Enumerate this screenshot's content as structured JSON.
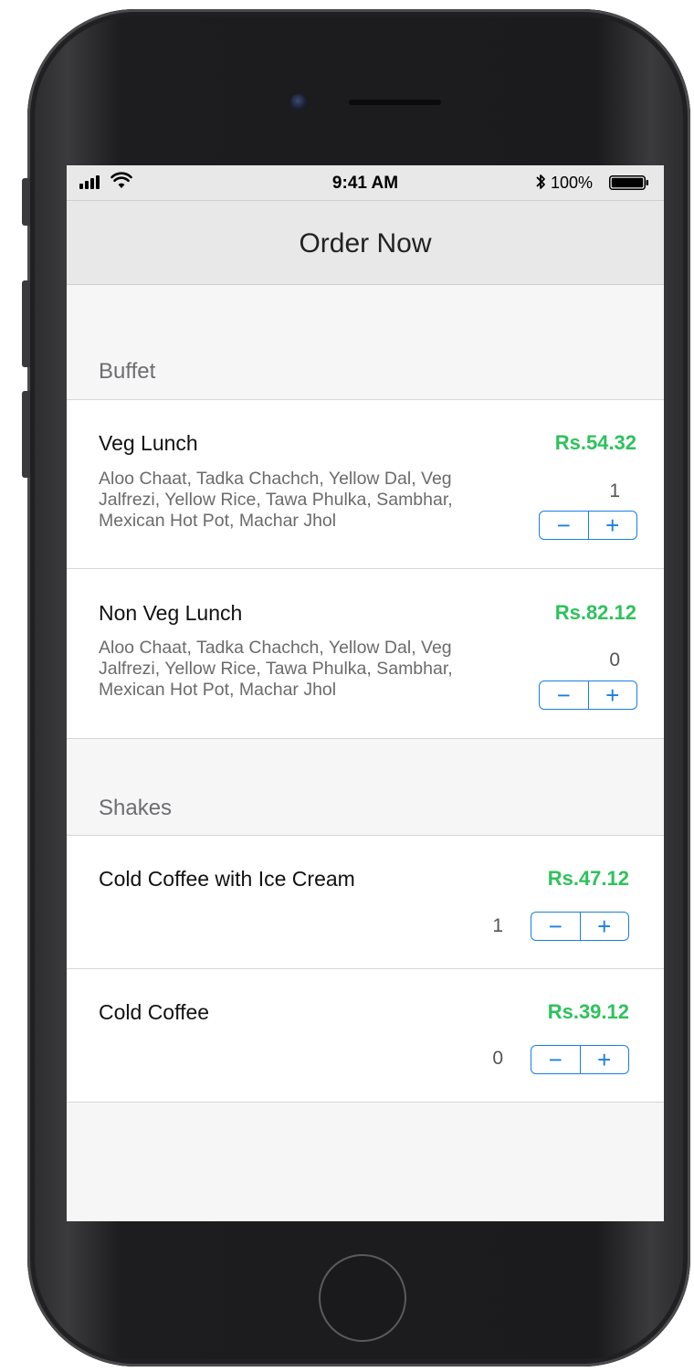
{
  "status_bar": {
    "time": "9:41 AM",
    "battery_percent": "100%",
    "icons": [
      "signal-icon",
      "wifi-icon",
      "bluetooth-icon",
      "battery-icon"
    ]
  },
  "nav": {
    "title": "Order Now"
  },
  "sections": [
    {
      "title": "Buffet",
      "items": [
        {
          "name": "Veg Lunch",
          "price": "Rs.54.32",
          "description": "Aloo Chaat, Tadka Chachch, Yellow Dal, Veg Jalfrezi, Yellow Rice, Tawa Phulka, Sambhar, Mexican Hot Pot, Machar Jhol",
          "quantity": "1"
        },
        {
          "name": "Non Veg Lunch",
          "price": "Rs.82.12",
          "description": "Aloo Chaat, Tadka Chachch, Yellow Dal, Veg Jalfrezi, Yellow Rice, Tawa Phulka, Sambhar, Mexican Hot Pot, Machar Jhol",
          "quantity": "0"
        }
      ]
    },
    {
      "title": "Shakes",
      "items": [
        {
          "name": "Cold Coffee with Ice Cream",
          "price": "Rs.47.12",
          "quantity": "1"
        },
        {
          "name": "Cold Coffee",
          "price": "Rs.39.12",
          "quantity": "0"
        }
      ]
    }
  ],
  "stepper": {
    "minus": "−",
    "plus": "+"
  },
  "colors": {
    "price": "#2ec25b",
    "accent": "#1a7fe0",
    "background": "#f6f6f6"
  }
}
